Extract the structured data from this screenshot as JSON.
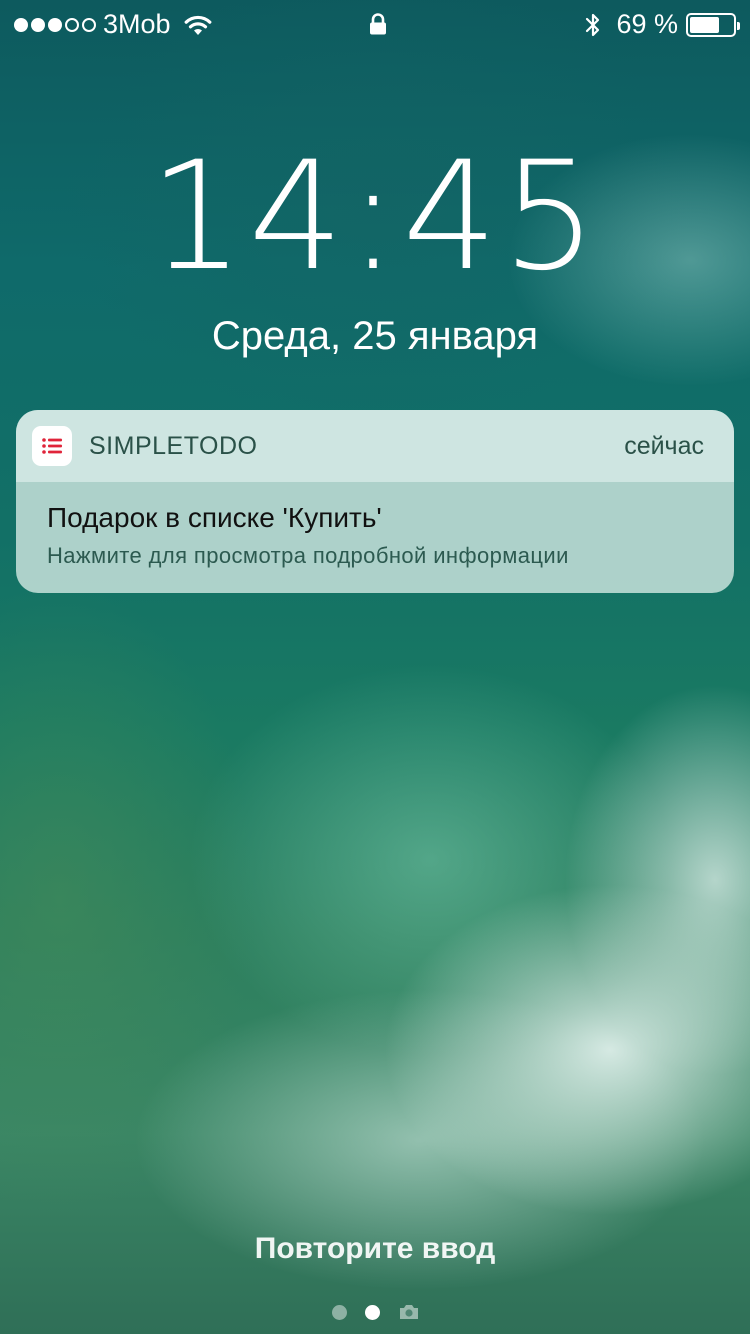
{
  "status_bar": {
    "signal_bars_total": 5,
    "signal_bars_filled": 3,
    "carrier": "3Mob",
    "battery_text": "69 %",
    "battery_level": 0.69,
    "icons": [
      "wifi-icon",
      "lock-icon",
      "bluetooth-icon",
      "battery-icon"
    ]
  },
  "lock_screen": {
    "time": "14:45",
    "date": "Среда, 25 января"
  },
  "notification": {
    "app_name": "SIMPLETODO",
    "time": "сейчас",
    "title": "Подарок в списке 'Купить'",
    "body": "Нажмите для просмотра подробной информации",
    "app_icon": "list-icon",
    "app_icon_color": "#e0243a"
  },
  "bottom": {
    "retry_label": "Повторите ввод",
    "page_count": 2,
    "active_page": 2,
    "trailing_icon": "camera-icon"
  },
  "colors": {
    "accent": "#e0243a",
    "notification_text": "#2a5148"
  }
}
